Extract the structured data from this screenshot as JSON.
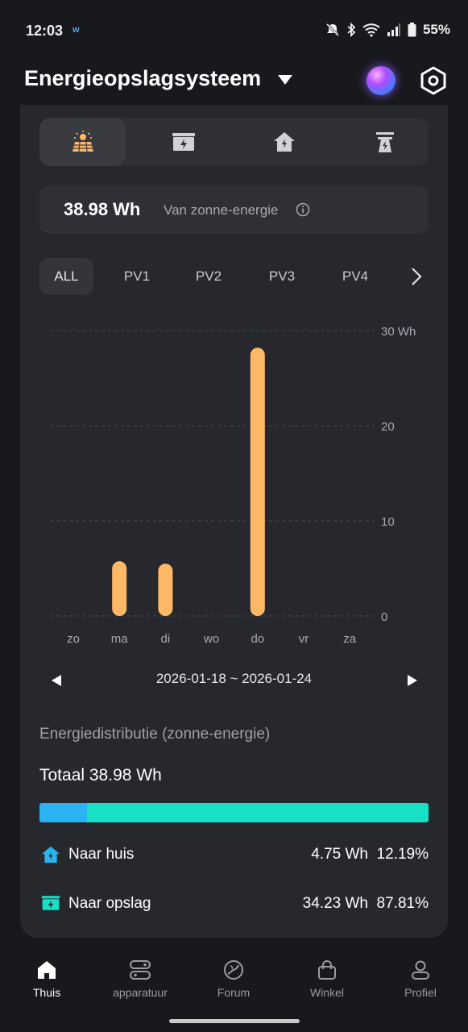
{
  "status_bar": {
    "time": "12:03",
    "app_icon": "w",
    "battery": "55%",
    "icons": [
      "mute-icon",
      "bluetooth-icon",
      "wifi-icon",
      "signal-icon",
      "battery-icon"
    ]
  },
  "header": {
    "title": "Energieopslagsysteem"
  },
  "tabs": [
    {
      "icon": "solar-panel-icon",
      "active": true
    },
    {
      "icon": "battery-storage-icon",
      "active": false
    },
    {
      "icon": "home-icon",
      "active": false
    },
    {
      "icon": "grid-tower-icon",
      "active": false
    }
  ],
  "summary": {
    "value": "38.98 Wh",
    "label": "Van zonne-energie"
  },
  "pv_filters": [
    "ALL",
    "PV1",
    "PV2",
    "PV3",
    "PV4"
  ],
  "pv_active": "ALL",
  "chart_data": {
    "type": "bar",
    "categories": [
      "zo",
      "ma",
      "di",
      "wo",
      "do",
      "vr",
      "za"
    ],
    "values": [
      0,
      5.75,
      5.5,
      0,
      28.2,
      0,
      0
    ],
    "ylim": [
      0,
      30
    ],
    "yticks": [
      "0",
      "10",
      "20",
      "30 Wh"
    ],
    "ytick_values": [
      0,
      10,
      20,
      30
    ],
    "grid": true,
    "color": "#ffb866"
  },
  "date_nav": {
    "range": "2026-01-18 ~ 2026-01-24"
  },
  "distribution": {
    "title": "Energiedistributie (zonne-energie)",
    "total": "Totaal 38.98 Wh",
    "home_fraction": 0.1219,
    "colors": {
      "home": "#2bb2f3",
      "storage": "#17e0c7"
    },
    "rows": [
      {
        "label": "Naar huis",
        "wh": "4.75 Wh",
        "pct": "12.19%"
      },
      {
        "label": "Naar opslag",
        "wh": "34.23 Wh",
        "pct": "87.81%"
      }
    ]
  },
  "bottom_nav": [
    {
      "label": "Thuis",
      "icon": "home-nav-icon",
      "active": true
    },
    {
      "label": "apparatuur",
      "icon": "devices-icon",
      "active": false
    },
    {
      "label": "Forum",
      "icon": "forum-icon",
      "active": false
    },
    {
      "label": "Winkel",
      "icon": "shop-bag-icon",
      "active": false
    },
    {
      "label": "Profiel",
      "icon": "profile-icon",
      "active": false
    }
  ]
}
